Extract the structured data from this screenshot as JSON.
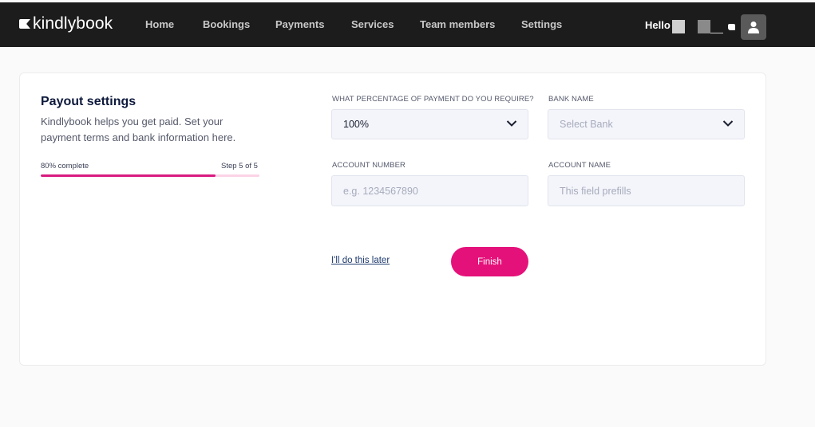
{
  "header": {
    "brand": "kindlybook",
    "nav": [
      "Home",
      "Bookings",
      "Payments",
      "Services",
      "Team members",
      "Settings"
    ],
    "greeting": "Hello"
  },
  "card": {
    "title": "Payout settings",
    "description": "Kindlybook helps you get paid. Set your payment terms and bank information here.",
    "progress": {
      "left_label": "80% complete",
      "right_label": "Step 5 of 5",
      "percent": 80
    }
  },
  "form": {
    "percentage": {
      "label": "WHAT PERCENTAGE OF PAYMENT DO YOU REQUIRE?",
      "value": "100%"
    },
    "bank": {
      "label": "BANK NAME",
      "placeholder": "Select Bank"
    },
    "account_number": {
      "label": "ACCOUNT NUMBER",
      "placeholder": "e.g. 1234567890"
    },
    "account_name": {
      "label": "ACCOUNT NAME",
      "placeholder": "This field prefills"
    },
    "later_link": "I'll do this later",
    "finish_button": "Finish"
  },
  "colors": {
    "accent": "#e5117a",
    "header_bg": "#1c1c1c",
    "progress_fill": "#d91a7f"
  }
}
